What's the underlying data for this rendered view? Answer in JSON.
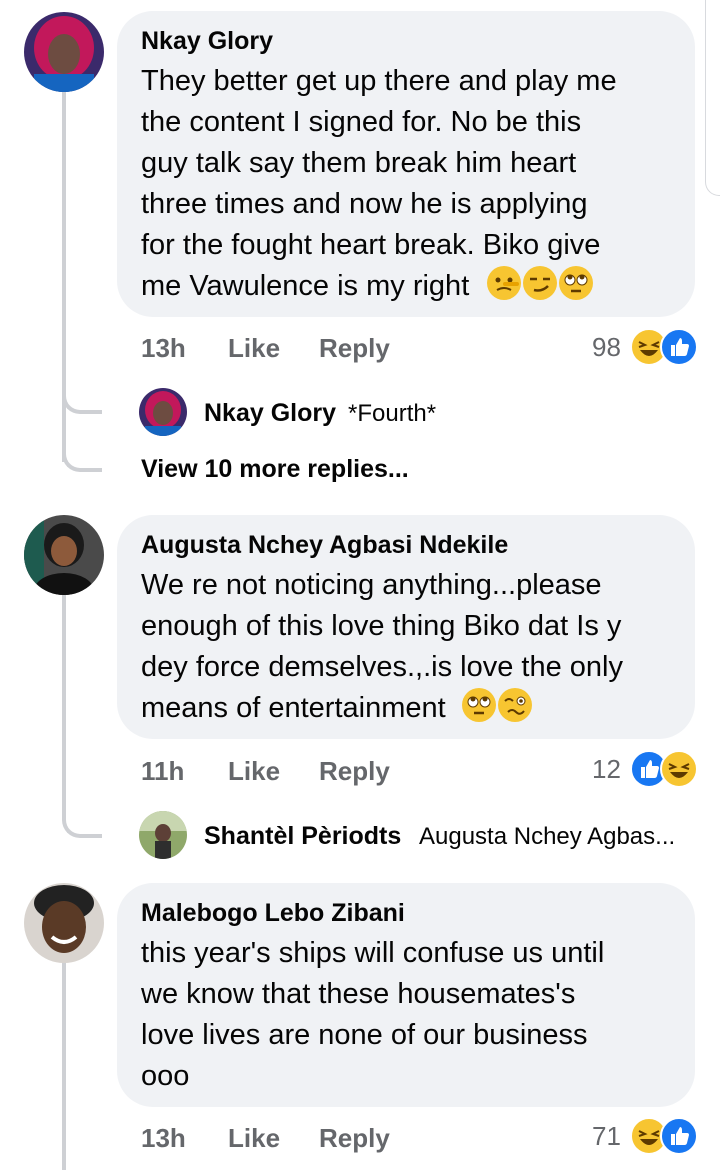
{
  "comments": [
    {
      "author": "Nkay Glory",
      "lines": [
        "They better get up there and play me",
        "the content I signed for. No be this",
        "guy talk say them break him heart",
        "three times and now he is applying",
        "for the fought heart break. Biko give",
        "me Vawulence is my right"
      ],
      "time": "13h",
      "like_label": "Like",
      "reply_label": "Reply",
      "reaction_count": "98",
      "reactions": [
        "haha",
        "like"
      ],
      "emojis": [
        "lying-face-emoji",
        "smirk-emoji",
        "eye-roll-emoji"
      ],
      "latest_reply": {
        "author": "Nkay Glory",
        "text": "*Fourth*"
      },
      "view_more": "View 10 more replies..."
    },
    {
      "author": "Augusta Nchey Agbasi Ndekile",
      "lines": [
        "We re not noticing anything...please",
        "enough of this love thing Biko dat Is y",
        "dey force demselves.,.is love the only",
        "means of entertainment"
      ],
      "time": "11h",
      "like_label": "Like",
      "reply_label": "Reply",
      "reaction_count": "12",
      "reactions": [
        "like",
        "haha"
      ],
      "emojis": [
        "eye-roll-emoji",
        "woozy-face-emoji"
      ],
      "latest_reply": {
        "author": "Shantèl Pèriodts",
        "text": "Augusta Nchey Agbas..."
      }
    },
    {
      "author": "Malebogo Lebo Zibani",
      "lines": [
        "this year's ships will confuse us until",
        "we know that these housemates's",
        "love lives are none of our business",
        "ooo"
      ],
      "time": "13h",
      "like_label": "Like",
      "reply_label": "Reply",
      "reaction_count": "71",
      "reactions": [
        "haha",
        "like"
      ]
    }
  ],
  "colors": {
    "bubble": "#f0f2f5",
    "meta": "#65676b",
    "like_blue": "#1877f2",
    "haha_yellow": "#f7c531",
    "thread_line": "#ced0d4"
  }
}
